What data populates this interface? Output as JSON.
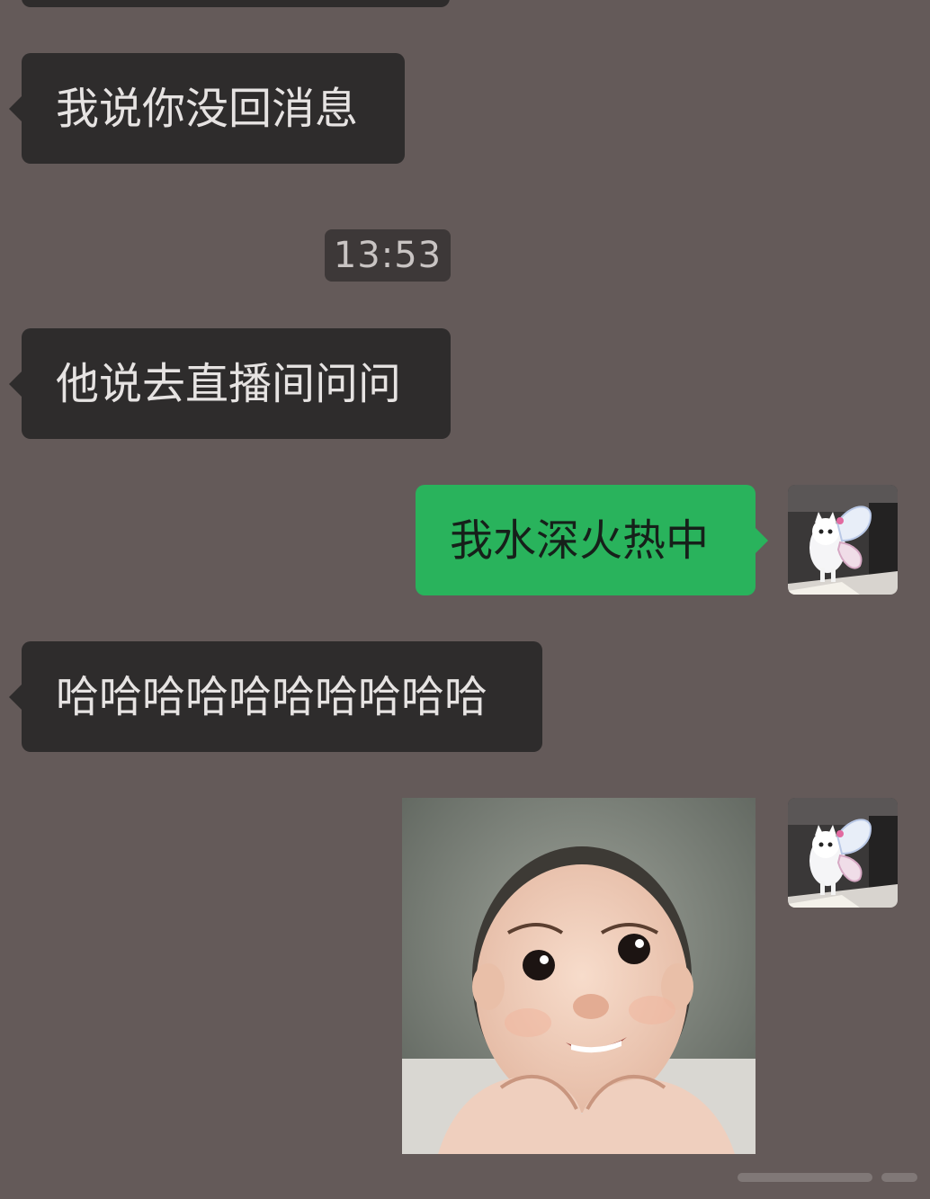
{
  "messages": {
    "m1": "我说你没回消息",
    "m2": "他说去直播间问问",
    "m3": "我水深火热中",
    "m4": "哈哈哈哈哈哈哈哈哈哈"
  },
  "timestamp": "13:53",
  "colors": {
    "background": "#645a59",
    "incoming_bubble": "#2e2c2c",
    "outgoing_bubble": "#29b35c"
  },
  "avatar_icon": "white-kitten-with-butterfly-wings",
  "photo_icon": "baby-making-heart-hands"
}
